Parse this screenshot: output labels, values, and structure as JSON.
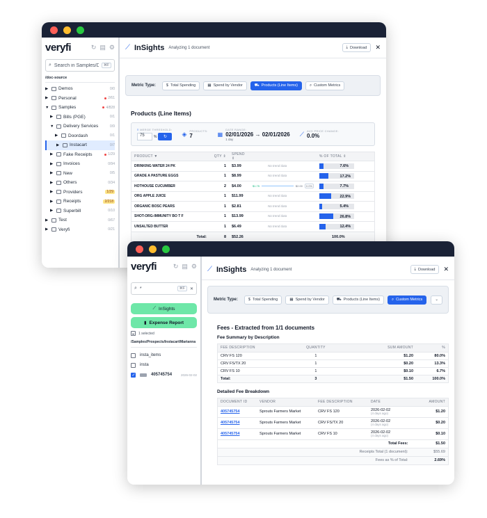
{
  "win1": {
    "sidebar": {
      "logo": "veryfi",
      "search_placeholder": "Search in Samples/Delive",
      "search_kbd": "⌘F",
      "root": "/doc-source",
      "tree": [
        {
          "label": "Demos",
          "count": "0/0",
          "indent": 0,
          "arrow": "▶"
        },
        {
          "label": "Personal",
          "count": "2/61",
          "indent": 0,
          "arrow": "▶",
          "dot": true
        },
        {
          "label": "Samples",
          "count": "4/828",
          "indent": 0,
          "arrow": "▼",
          "dot": true
        },
        {
          "label": "Bills (PGE)",
          "count": "0/1",
          "indent": 1,
          "arrow": "▶"
        },
        {
          "label": "Delivery Services",
          "count": "0/9",
          "indent": 1,
          "arrow": "▼"
        },
        {
          "label": "Doordash",
          "count": "0/1",
          "indent": 2,
          "arrow": "▶"
        },
        {
          "label": "Instacart",
          "count": "0/7",
          "indent": 2,
          "arrow": "▶",
          "selected": true
        },
        {
          "label": "Fake Receipts",
          "count": "1/29",
          "indent": 1,
          "arrow": "▶",
          "dot": true
        },
        {
          "label": "Invoices",
          "count": "0/94",
          "indent": 1,
          "arrow": "▶"
        },
        {
          "label": "New",
          "count": "0/5",
          "indent": 1,
          "arrow": "▶"
        },
        {
          "label": "Others",
          "count": "0/34",
          "indent": 1,
          "arrow": "▶"
        },
        {
          "label": "Providers",
          "count": "1/29",
          "indent": 1,
          "arrow": "▶",
          "badge": true
        },
        {
          "label": "Receipts",
          "count": "2/218",
          "indent": 1,
          "arrow": "▶",
          "badge": true
        },
        {
          "label": "Superbill",
          "count": "0/10",
          "indent": 1,
          "arrow": "▶"
        },
        {
          "label": "Test",
          "count": "0/67",
          "indent": 0,
          "arrow": "▶"
        },
        {
          "label": "Veryfi",
          "count": "0/21",
          "indent": 0,
          "arrow": "▶"
        }
      ]
    },
    "header": {
      "title": "InSights",
      "subtitle": "Analyzing 1 document",
      "download": "Download",
      "close": "✕"
    },
    "metric": {
      "label": "Metric Type:",
      "b1": "Total Spending",
      "b2": "Spend by Vendor",
      "b3": "Products (Line Items)",
      "b4": "Custom Metrics"
    },
    "section": "Products (Line Items)",
    "stats": {
      "merge_label": "MERGE THRESHOLD:",
      "merge_value": "75",
      "merge_unit": "%",
      "products_label": "PRODUCTS:",
      "products_value": "7",
      "date_label": "DATE RANGE:",
      "date_value": "02/01/2026 → 02/01/2026",
      "date_sub": "1 day",
      "change_label": "AVG PRICE CHANGE:",
      "change_value": "0.0%"
    },
    "table": {
      "headers": [
        "PRODUCT ▼",
        "QTY ⇕",
        "SPEND ⇕",
        "",
        "% OF TOTAL ⇕"
      ],
      "rows": [
        {
          "name": "DRINKING WATER 24 PK",
          "qty": "1",
          "spend": "$3.99",
          "trend": "No trend data",
          "pct": "7.6%",
          "frac": 0.076
        },
        {
          "name": "GRADE A PASTURE EGGS",
          "qty": "1",
          "spend": "$8.99",
          "trend": "No trend data",
          "pct": "17.2%",
          "frac": 0.172
        },
        {
          "name": "HOTHOUSE CUCUMBER",
          "qty": "2",
          "spend": "$4.00",
          "trend": "",
          "tlo": "$1.75",
          "thi": "$2.00",
          "tbadge": "0.0%",
          "pct": "7.7%",
          "frac": 0.077
        },
        {
          "name": "ORG APPLE JUICE",
          "qty": "1",
          "spend": "$11.99",
          "trend": "No trend data",
          "pct": "22.9%",
          "frac": 0.229
        },
        {
          "name": "ORGANIC BOSC PEARS",
          "qty": "1",
          "spend": "$2.81",
          "trend": "No trend data",
          "pct": "5.4%",
          "frac": 0.054
        },
        {
          "name": "SHOT-ORG-IMMUNITY BO T F",
          "qty": "1",
          "spend": "$13.99",
          "trend": "No trend data",
          "pct": "26.8%",
          "frac": 0.268
        },
        {
          "name": "UNSALTED BUTTER",
          "qty": "1",
          "spend": "$6.49",
          "trend": "No trend data",
          "pct": "12.4%",
          "frac": 0.124
        }
      ],
      "total_label": "Total:",
      "total_qty": "8",
      "total_spend": "$52.26",
      "total_pct": "100.0%"
    }
  },
  "win2": {
    "sidebar": {
      "logo": "veryfi",
      "search_value": "*",
      "search_kbd": "⌘F",
      "insights_btn": "InSights",
      "expense_btn": "Expense Report",
      "selected_count": "1 selected",
      "path": "/Samples/Prospects/Instacart/Marianna",
      "files": [
        {
          "label": "insta_items",
          "checked": false
        },
        {
          "label": "insta",
          "checked": false
        },
        {
          "label": "405745754",
          "date": "2026-02-02",
          "checked": true
        }
      ]
    },
    "header": {
      "title": "InSights",
      "subtitle": "Analyzing 1 document",
      "download": "Download",
      "close": "✕"
    },
    "metric": {
      "label": "Metric Type:",
      "b1": "Total Spending",
      "b2": "Spend by Vendor",
      "b3": "Products (Line Items)",
      "b4": "Custom Metrics",
      "b5": "⌄"
    },
    "section": "Fees - Extracted from 1/1 documents",
    "summary": {
      "title": "Fee Summary by Description",
      "headers": [
        "FEE DESCRIPTION",
        "QUANTITY",
        "SUM AMOUNT",
        "%"
      ],
      "rows": [
        {
          "desc": "CRV FS 120",
          "qty": "1",
          "amt": "$1.20",
          "pct": "80.0%"
        },
        {
          "desc": "CRV FS/TX 20",
          "qty": "1",
          "amt": "$0.20",
          "pct": "13.3%"
        },
        {
          "desc": "CRV FS 10",
          "qty": "1",
          "amt": "$0.10",
          "pct": "6.7%"
        }
      ],
      "total_label": "Total:",
      "total_qty": "3",
      "total_amt": "$1.50",
      "total_pct": "100.0%"
    },
    "detail": {
      "title": "Detailed Fee Breakdown",
      "headers": [
        "DOCUMENT ID",
        "VENDOR",
        "FEE DESCRIPTION",
        "DATE",
        "AMOUNT"
      ],
      "rows": [
        {
          "id": "405745754",
          "vendor": "Sprouts Farmers Market",
          "desc": "CRV FS 120",
          "date": "2026-02-02",
          "ago": "(4 days ago)",
          "amt": "$1.20"
        },
        {
          "id": "405745754",
          "vendor": "Sprouts Farmers Market",
          "desc": "CRV FS/TX 20",
          "date": "2026-02-02",
          "ago": "(4 days ago)",
          "amt": "$0.20"
        },
        {
          "id": "405745754",
          "vendor": "Sprouts Farmers Market",
          "desc": "CRV FS 10",
          "date": "2026-02-02",
          "ago": "(4 days ago)",
          "amt": "$0.10"
        }
      ],
      "total_fees_label": "Total Fees:",
      "total_fees": "$1.50",
      "receipts_label": "Receipts Total (1 document):",
      "receipts_total": "$55.69",
      "pct_label": "Fees as % of Total:",
      "pct_total": "2.69%"
    }
  }
}
